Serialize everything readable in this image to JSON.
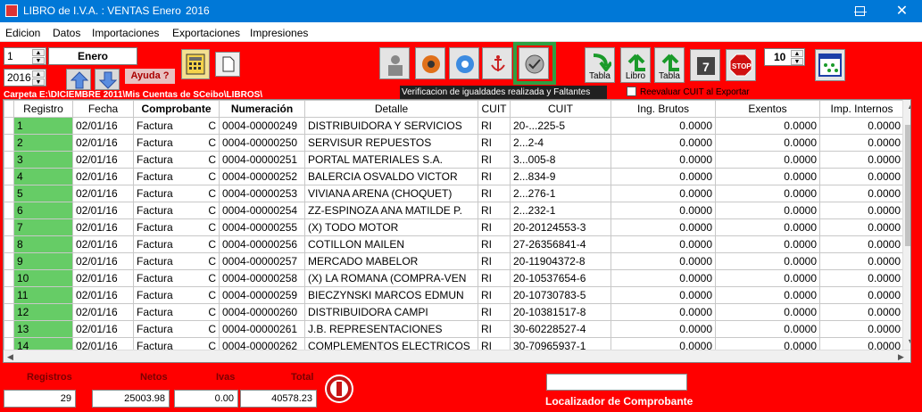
{
  "window": {
    "title": "LIBRO de I.V.A. : VENTAS Enero",
    "year": "2016"
  },
  "menu": [
    "Edicion",
    "Datos",
    "Importaciones",
    "Exportaciones",
    "Impresiones"
  ],
  "period": {
    "month_number": "1",
    "month_name": "Enero",
    "year": "2016"
  },
  "help_label": "Ayuda ?",
  "buttons": {
    "tabla1": "Tabla",
    "libro": "Libro",
    "tabla2": "Tabla"
  },
  "page_size_value": "10",
  "folder_path": "Carpeta E:\\DICIEMBRE 2011\\Mis Cuentas de SCeibo\\LIBROS\\",
  "tooltip": "Verificacion de igualdades realizada y Faltantes",
  "reevaluar_label": "Reevaluar CUIT al Exportar",
  "columns": [
    "Registro",
    "Fecha",
    "Comprobante",
    "Numeración",
    "Detalle",
    "CUIT",
    "CUIT",
    "Ing. Brutos",
    "Exentos",
    "Imp. Internos"
  ],
  "rows": [
    {
      "reg": "1",
      "fecha": "02/01/16",
      "comp": "Factura",
      "tipo": "C",
      "num": "0004-00000249",
      "detalle": "DISTRIBUIDORA Y SERVICIOS",
      "cond": "RI",
      "cuit": "20-...225-5",
      "ib": "0.0000",
      "ex": "0.0000",
      "ii": "0.0000"
    },
    {
      "reg": "2",
      "fecha": "02/01/16",
      "comp": "Factura",
      "tipo": "C",
      "num": "0004-00000250",
      "detalle": "SERVISUR REPUESTOS",
      "cond": "RI",
      "cuit": "2...2-4",
      "ib": "0.0000",
      "ex": "0.0000",
      "ii": "0.0000"
    },
    {
      "reg": "3",
      "fecha": "02/01/16",
      "comp": "Factura",
      "tipo": "C",
      "num": "0004-00000251",
      "detalle": "PORTAL MATERIALES S.A.",
      "cond": "RI",
      "cuit": "3...005-8",
      "ib": "0.0000",
      "ex": "0.0000",
      "ii": "0.0000"
    },
    {
      "reg": "4",
      "fecha": "02/01/16",
      "comp": "Factura",
      "tipo": "C",
      "num": "0004-00000252",
      "detalle": "BALERCIA OSVALDO VICTOR",
      "cond": "RI",
      "cuit": "2...834-9",
      "ib": "0.0000",
      "ex": "0.0000",
      "ii": "0.0000"
    },
    {
      "reg": "5",
      "fecha": "02/01/16",
      "comp": "Factura",
      "tipo": "C",
      "num": "0004-00000253",
      "detalle": "VIVIANA ARENA (CHOQUET)",
      "cond": "RI",
      "cuit": "2...276-1",
      "ib": "0.0000",
      "ex": "0.0000",
      "ii": "0.0000"
    },
    {
      "reg": "6",
      "fecha": "02/01/16",
      "comp": "Factura",
      "tipo": "C",
      "num": "0004-00000254",
      "detalle": "ZZ-ESPINOZA ANA MATILDE P.",
      "cond": "RI",
      "cuit": "2...232-1",
      "ib": "0.0000",
      "ex": "0.0000",
      "ii": "0.0000"
    },
    {
      "reg": "7",
      "fecha": "02/01/16",
      "comp": "Factura",
      "tipo": "C",
      "num": "0004-00000255",
      "detalle": "(X) TODO MOTOR",
      "cond": "RI",
      "cuit": "20-20124553-3",
      "ib": "0.0000",
      "ex": "0.0000",
      "ii": "0.0000"
    },
    {
      "reg": "8",
      "fecha": "02/01/16",
      "comp": "Factura",
      "tipo": "C",
      "num": "0004-00000256",
      "detalle": "COTILLON MAILEN",
      "cond": "RI",
      "cuit": "27-26356841-4",
      "ib": "0.0000",
      "ex": "0.0000",
      "ii": "0.0000"
    },
    {
      "reg": "9",
      "fecha": "02/01/16",
      "comp": "Factura",
      "tipo": "C",
      "num": "0004-00000257",
      "detalle": "MERCADO MABELOR",
      "cond": "RI",
      "cuit": "20-11904372-8",
      "ib": "0.0000",
      "ex": "0.0000",
      "ii": "0.0000"
    },
    {
      "reg": "10",
      "fecha": "02/01/16",
      "comp": "Factura",
      "tipo": "C",
      "num": "0004-00000258",
      "detalle": "(X) LA ROMANA (COMPRA-VEN",
      "cond": "RI",
      "cuit": "20-10537654-6",
      "ib": "0.0000",
      "ex": "0.0000",
      "ii": "0.0000"
    },
    {
      "reg": "11",
      "fecha": "02/01/16",
      "comp": "Factura",
      "tipo": "C",
      "num": "0004-00000259",
      "detalle": "BIECZYNSKI MARCOS EDMUN",
      "cond": "RI",
      "cuit": "20-10730783-5",
      "ib": "0.0000",
      "ex": "0.0000",
      "ii": "0.0000"
    },
    {
      "reg": "12",
      "fecha": "02/01/16",
      "comp": "Factura",
      "tipo": "C",
      "num": "0004-00000260",
      "detalle": "DISTRIBUIDORA CAMPI",
      "cond": "RI",
      "cuit": "20-10381517-8",
      "ib": "0.0000",
      "ex": "0.0000",
      "ii": "0.0000"
    },
    {
      "reg": "13",
      "fecha": "02/01/16",
      "comp": "Factura",
      "tipo": "C",
      "num": "0004-00000261",
      "detalle": "J.B. REPRESENTACIONES",
      "cond": "RI",
      "cuit": "30-60228527-4",
      "ib": "0.0000",
      "ex": "0.0000",
      "ii": "0.0000"
    },
    {
      "reg": "14",
      "fecha": "02/01/16",
      "comp": "Factura",
      "tipo": "C",
      "num": "0004-00000262",
      "detalle": "COMPLEMENTOS ELECTRICOS",
      "cond": "RI",
      "cuit": "30-70965937-1",
      "ib": "0.0000",
      "ex": "0.0000",
      "ii": "0.0000"
    }
  ],
  "totals": {
    "registros_label": "Registros",
    "netos_label": "Netos",
    "ivas_label": "Ivas",
    "total_label": "Total",
    "registros": "29",
    "netos": "25003.98",
    "ivas": "0.00",
    "total": "40578.23"
  },
  "locator_label": "Localizador de Comprobante",
  "colors": {
    "background": "#ff0000",
    "titlebar": "#0078d7",
    "registro_cell": "#66cc66",
    "highlight": "#2ea043"
  }
}
